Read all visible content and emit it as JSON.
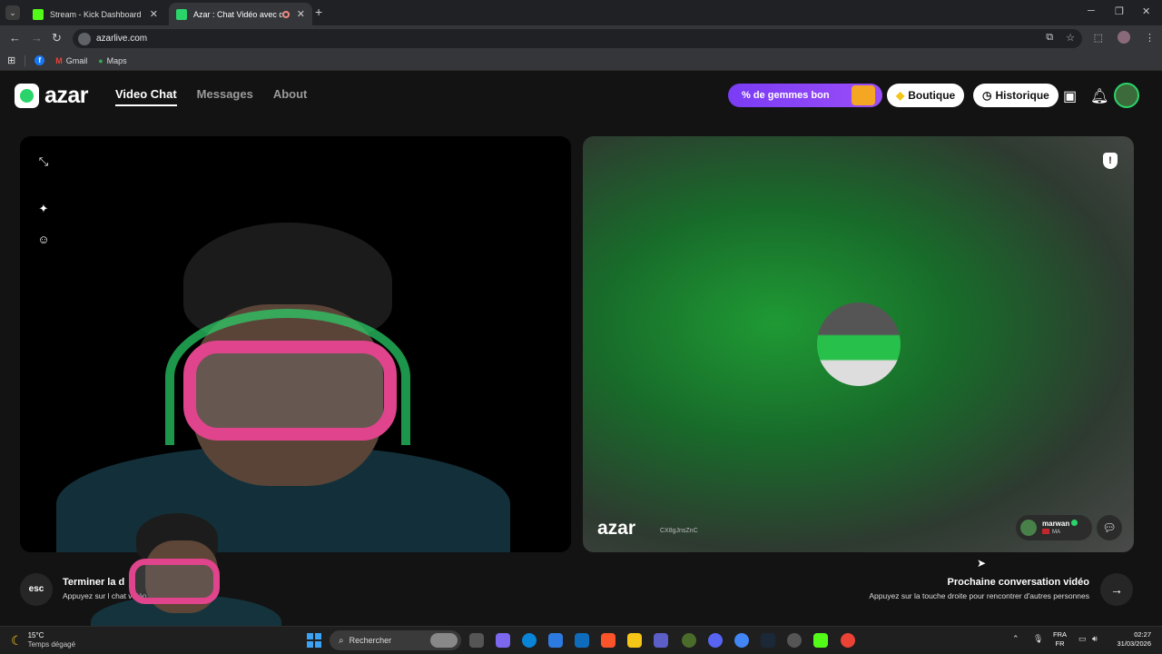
{
  "browser": {
    "tabs": [
      {
        "title": "Stream - Kick Dashboard",
        "favicon_color": "#53fc18"
      },
      {
        "title": "Azar : Chat Vidéo avec de n",
        "favicon_color": "#2ad46a"
      }
    ],
    "url": "azarlive.com",
    "bookmarks": [
      {
        "label": ""
      },
      {
        "label": "Gmail"
      },
      {
        "label": "Maps"
      }
    ]
  },
  "azar": {
    "logo_text": "azar",
    "nav": [
      {
        "label": "Video Chat",
        "active": true
      },
      {
        "label": "Messages",
        "active": false
      },
      {
        "label": "About",
        "active": false
      }
    ],
    "promo": "% de gemmes bon",
    "shop_label": "Boutique",
    "history_label": "Historique",
    "icons": [
      "store-icon",
      "bell-icon"
    ],
    "remote": {
      "watermark": "azar",
      "session_id": "CX8gJnsZnC",
      "user_name": "marwan",
      "user_country": "MA"
    },
    "end": {
      "key": "esc",
      "title": "Terminer la d",
      "hint": "Appuyez sur l                       chat vidéo."
    },
    "next": {
      "title": "Prochaine conversation vidéo",
      "hint": "Appuyez sur la touche droite pour rencontrer d'autres personnes"
    }
  },
  "taskbar": {
    "temperature": "15°C",
    "weather": "Temps dégagé",
    "search_placeholder": "Rechercher",
    "lang_top": "FRA",
    "lang_bottom": "FR",
    "time": "02:27",
    "date": "31/03/2026"
  },
  "colors": {
    "accent_green": "#2ad46a",
    "promo_purple": "#7a3cf5",
    "mask_pink": "#e0448c"
  }
}
